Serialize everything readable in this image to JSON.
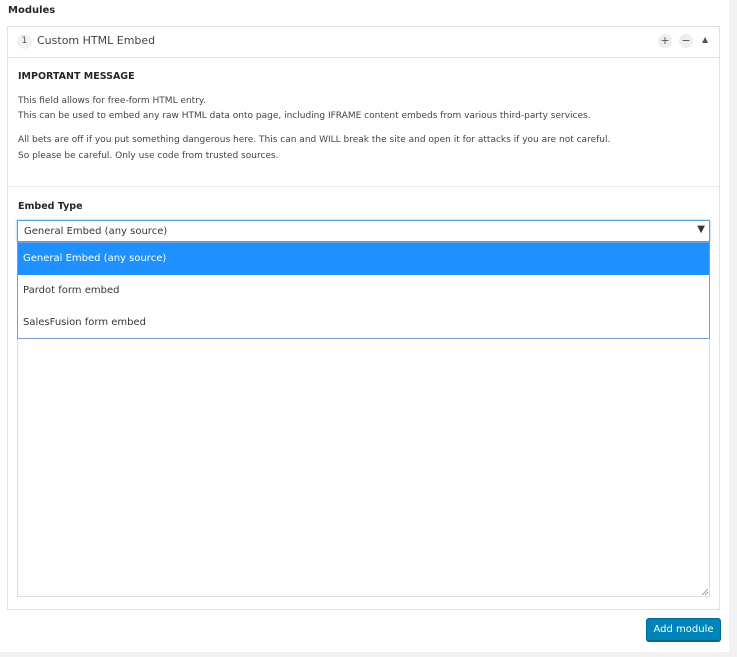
{
  "page": {
    "section_title": "Modules"
  },
  "module": {
    "number": "1",
    "title": "Custom HTML Embed",
    "add_symbol": "+",
    "remove_symbol": "−",
    "collapse_symbol": "▲"
  },
  "message": {
    "heading": "IMPORTANT MESSAGE",
    "line1": "This field allows for free-form HTML entry.",
    "line2": "This can be used to embed any raw HTML data onto page, including IFRAME content embeds from various third-party services.",
    "line3": "All bets are off if you put something dangerous here. This can and WILL break the site and open it for attacks if you are not careful.",
    "line4": "So please be careful. Only use code from trusted sources."
  },
  "embed": {
    "label": "Embed Type",
    "selected": "General Embed (any source)",
    "arrow": "▼",
    "options": [
      "General Embed (any source)",
      "Pardot form embed",
      "SalesFusion form embed"
    ]
  },
  "footer": {
    "add_module_label": "Add module"
  },
  "colors": {
    "accent": "#0085ba",
    "selected_option": "#1e90ff"
  },
  "icons": {
    "add": "plus-icon",
    "remove": "minus-icon",
    "collapse": "collapse-arrow-icon",
    "dropdown": "dropdown-arrow-icon"
  }
}
